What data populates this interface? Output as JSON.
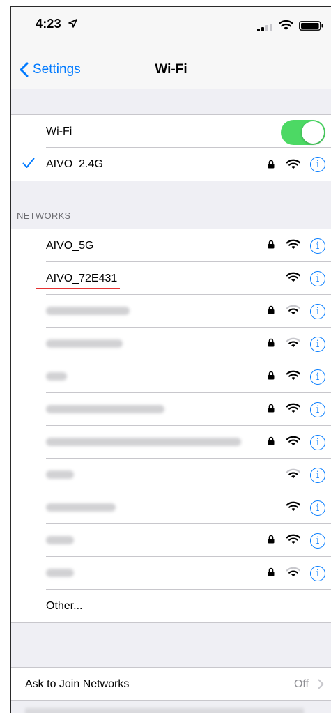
{
  "status_bar": {
    "time": "4:23"
  },
  "nav": {
    "back_label": "Settings",
    "title": "Wi-Fi"
  },
  "wifi_toggle": {
    "label": "Wi-Fi",
    "enabled": true
  },
  "connected": {
    "name": "AIVO_2.4G",
    "secured": true,
    "signal": 3
  },
  "networks_header": "NETWORKS",
  "networks": [
    {
      "name": "AIVO_5G",
      "secured": true,
      "signal": 3
    },
    {
      "name": "AIVO_72E431",
      "secured": false,
      "signal": 3,
      "underlined": true
    },
    {
      "name": "",
      "blurred": true,
      "secured": true,
      "signal": 2
    },
    {
      "name": "",
      "blurred": true,
      "secured": true,
      "signal": 2
    },
    {
      "name": "",
      "blurred": true,
      "secured": true,
      "signal": 3
    },
    {
      "name": "",
      "blurred": true,
      "secured": true,
      "signal": 3
    },
    {
      "name": "",
      "blurred": true,
      "secured": true,
      "signal": 3
    },
    {
      "name": "",
      "blurred": true,
      "secured": false,
      "signal": 2
    },
    {
      "name": "",
      "blurred": true,
      "secured": false,
      "signal": 3
    },
    {
      "name": "",
      "blurred": true,
      "secured": true,
      "signal": 3
    },
    {
      "name": "",
      "blurred": true,
      "secured": true,
      "signal": 2
    }
  ],
  "other_label": "Other...",
  "ask_to_join": {
    "label": "Ask to Join Networks",
    "value": "Off"
  },
  "colors": {
    "accent": "#007aff",
    "toggle_on": "#4cd964",
    "underline": "#e53030"
  }
}
